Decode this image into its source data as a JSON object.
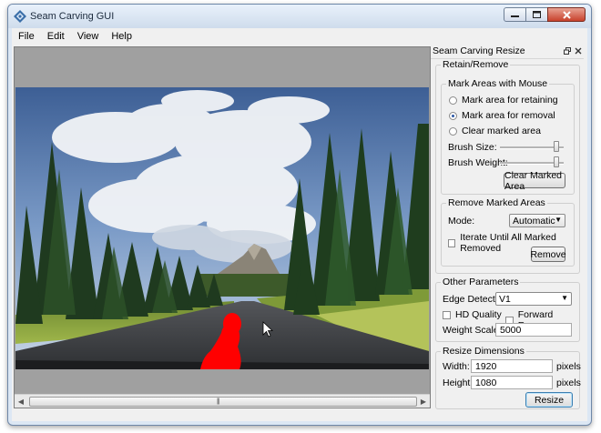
{
  "window": {
    "title": "Seam Carving GUI"
  },
  "menu": [
    "File",
    "Edit",
    "View",
    "Help"
  ],
  "dock": {
    "title": "Seam Carving Resize",
    "retain_remove": {
      "label": "Retain/Remove",
      "mark_areas": {
        "label": "Mark Areas with Mouse",
        "options": [
          "Mark area for retaining",
          "Mark area for removal",
          "Clear marked area"
        ],
        "selected_index": 1,
        "brush_size_label": "Brush Size:",
        "brush_size_level": 0.93,
        "brush_weight_label": "Brush Weight:",
        "brush_weight_level": 0.93,
        "clear_button": "Clear Marked Area"
      },
      "remove_marked": {
        "label": "Remove Marked Areas",
        "mode_label": "Mode:",
        "mode_value": "Automatic",
        "iterate_label": "Iterate Until All Marked Removed",
        "iterate_checked": false,
        "remove_button": "Remove"
      }
    },
    "other_params": {
      "label": "Other Parameters",
      "edge_detector_label": "Edge Detector:",
      "edge_detector_value": "V1",
      "hd_quality_label": "HD Quality",
      "hd_quality_checked": false,
      "forward_energy_label": "Forward Energy",
      "forward_energy_checked": false,
      "weight_scale_label": "Weight Scale:",
      "weight_scale_value": "5000"
    },
    "resize_dims": {
      "label": "Resize Dimensions",
      "width_label": "Width:",
      "width_value": "1920",
      "width_unit": "pixels",
      "height_label": "Height:",
      "height_value": "1080",
      "height_unit": "pixels",
      "resize_button": "Resize"
    }
  },
  "colors": {
    "removal_mask": "#ff0000",
    "selected_radio": "#2a57a6",
    "default_button_border": "#3c7fb1"
  },
  "icons": [
    "app-icon",
    "minimize-icon",
    "maximize-icon",
    "close-icon",
    "dock-float-icon",
    "dock-close-icon",
    "scroll-left-icon",
    "scroll-right-icon",
    "dropdown-arrow-icon",
    "mouse-cursor-icon"
  ]
}
